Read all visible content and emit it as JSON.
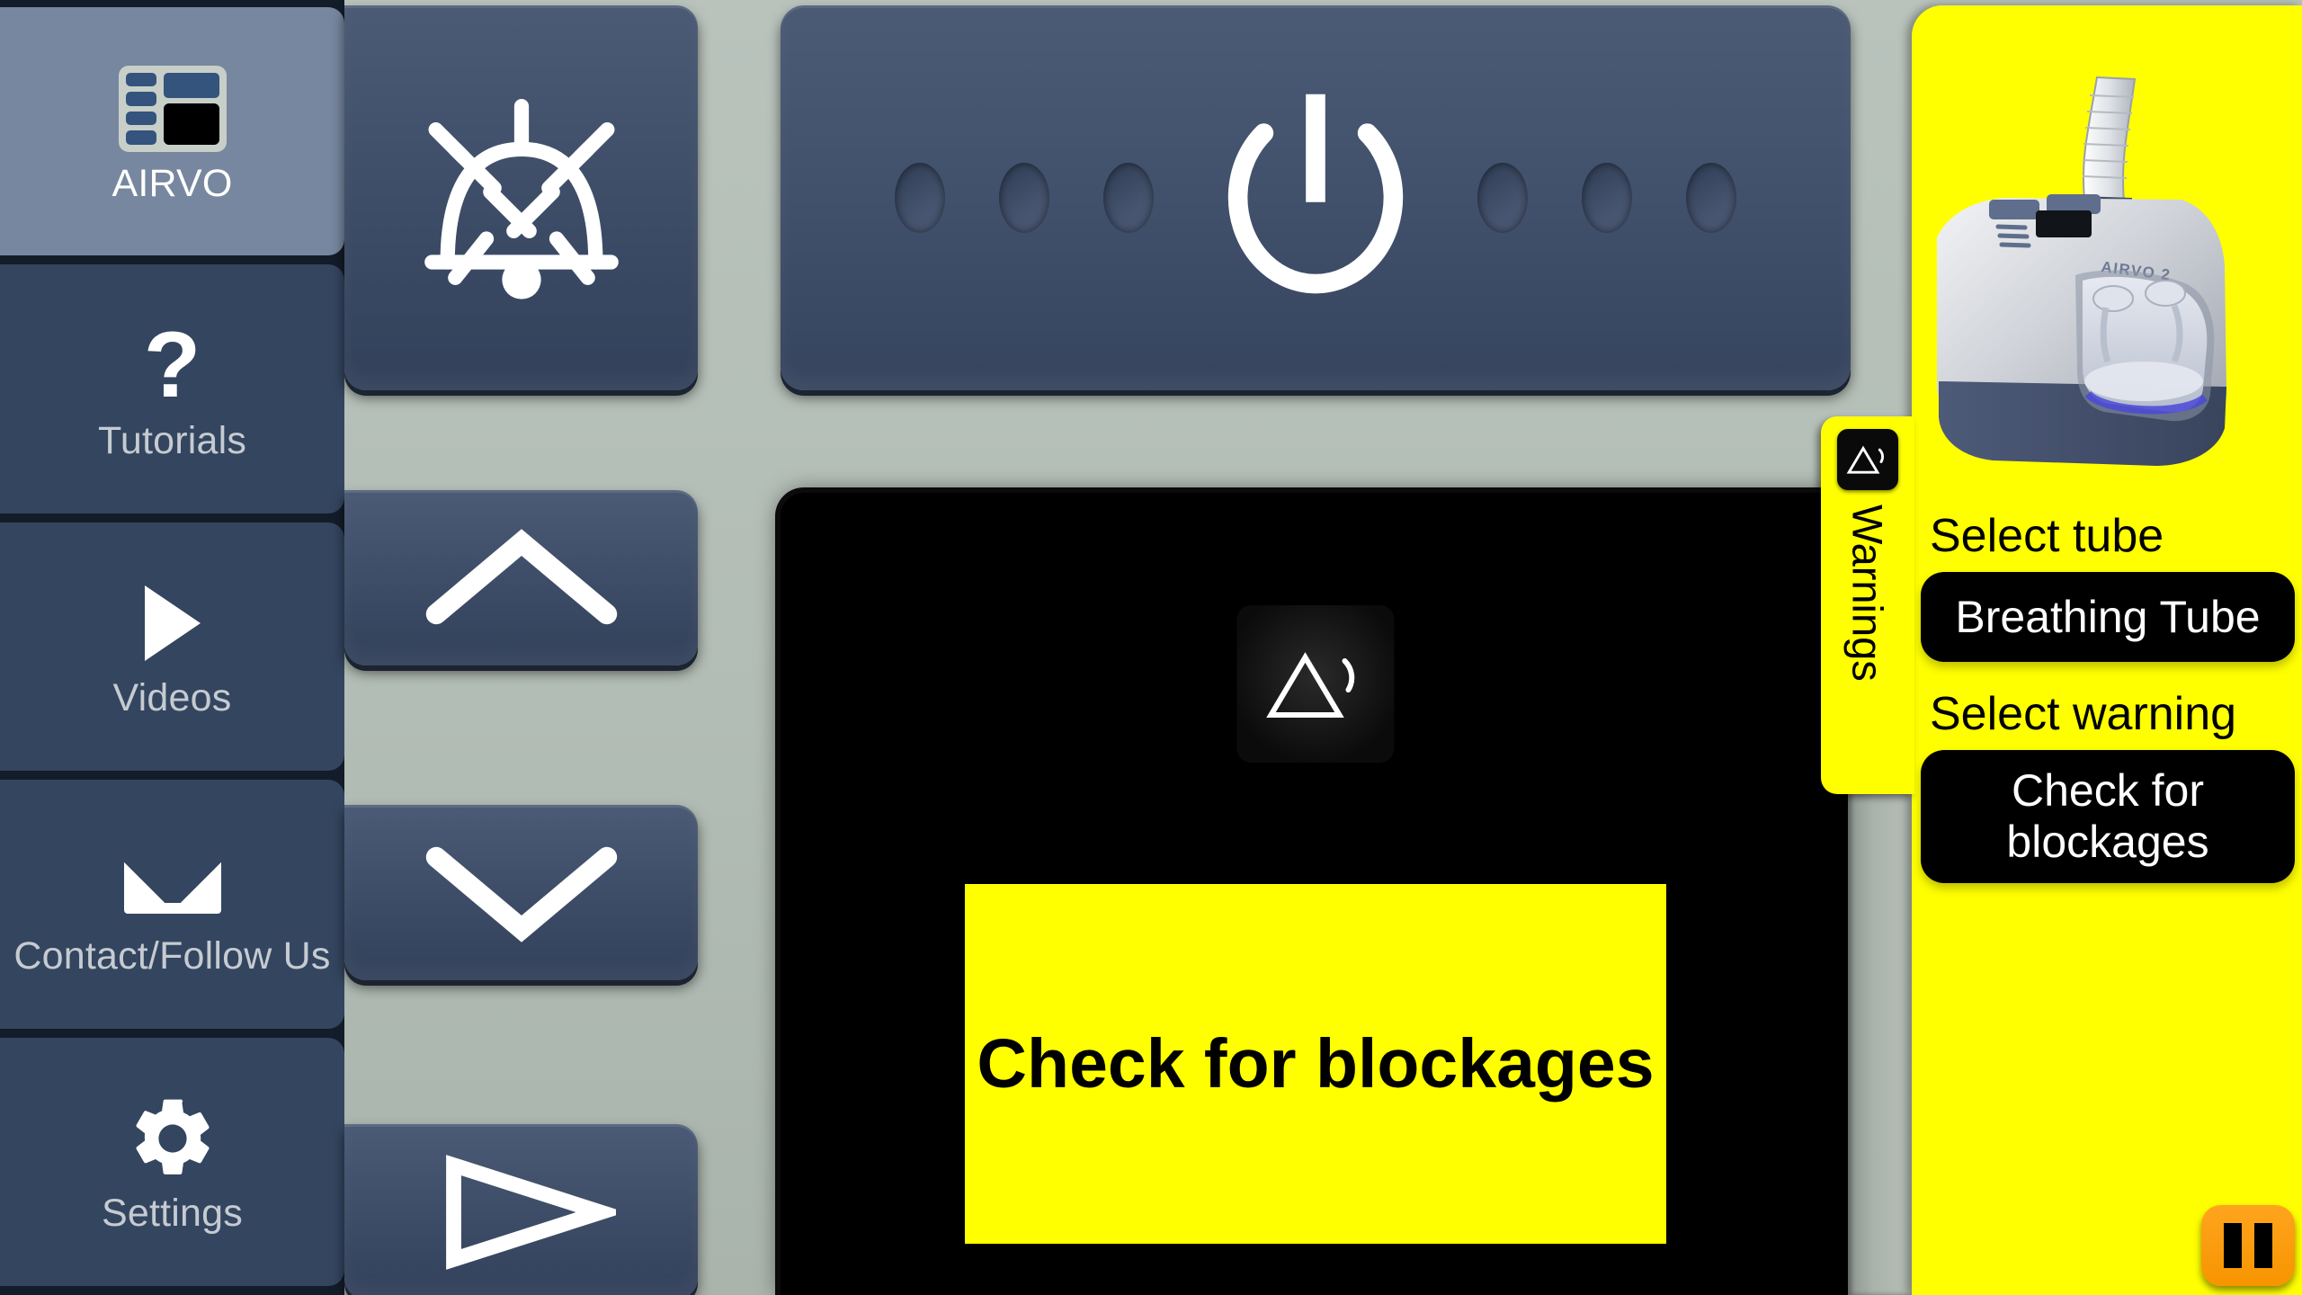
{
  "sidebar": {
    "items": [
      {
        "label": "AIRVO",
        "icon": "airvo-panel-icon",
        "active": true
      },
      {
        "label": "Tutorials",
        "icon": "question-mark-icon",
        "active": false
      },
      {
        "label": "Videos",
        "icon": "play-triangle-icon",
        "active": false
      },
      {
        "label": "Contact/Follow Us",
        "icon": "envelope-icon",
        "active": false
      },
      {
        "label": "Settings",
        "icon": "gear-icon",
        "active": false
      }
    ]
  },
  "device": {
    "buttons": [
      {
        "name": "alarm-mute-button",
        "icon": "bell-muted-icon"
      },
      {
        "name": "power-button",
        "icon": "power-icon"
      },
      {
        "name": "up-button",
        "icon": "chevron-up-icon"
      },
      {
        "name": "down-button",
        "icon": "chevron-down-icon"
      },
      {
        "name": "mode-button",
        "icon": "triangle-outline-icon"
      }
    ],
    "vent_count": 6
  },
  "screen": {
    "alarm_icon": "alarm-triangle-sound-icon",
    "banner_text": "Check for blockages",
    "banner_color": "#ffff00",
    "background_color": "#000000"
  },
  "warnings_panel": {
    "tab_label": "Warnings",
    "tab_icon": "alarm-triangle-sound-icon",
    "device_photo_label": "AIRVO 2",
    "tube_label": "Select tube",
    "tube_value": "Breathing Tube",
    "warning_label": "Select warning",
    "warning_value": "Check for blockages",
    "pause_button": "pause-icon",
    "panel_color": "#ffff00",
    "accent_color": "#f79500"
  }
}
